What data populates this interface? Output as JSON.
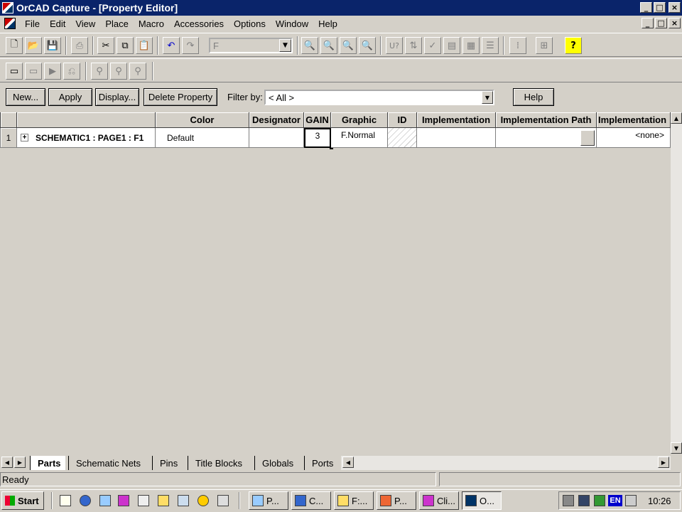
{
  "window": {
    "title": "OrCAD Capture - [Property Editor]",
    "min": "_",
    "max": "□",
    "close": "×"
  },
  "menu": {
    "items": [
      "File",
      "Edit",
      "View",
      "Place",
      "Macro",
      "Accessories",
      "Options",
      "Window",
      "Help"
    ]
  },
  "toolbar": {
    "part_combo": "F"
  },
  "editor": {
    "new_label": "New...",
    "apply_label": "Apply",
    "display_label": "Display...",
    "delete_label": "Delete Property",
    "filter_label": "Filter by:",
    "filter_value": "< All >",
    "help_label": "Help"
  },
  "grid": {
    "headers": [
      "Color",
      "Designator",
      "GAIN",
      "Graphic",
      "ID",
      "Implementation",
      "Implementation Path",
      "Implementation"
    ],
    "row": {
      "number": "1",
      "expand": "+",
      "name": "SCHEMATIC1 : PAGE1 : F1",
      "color": "Default",
      "designator": "",
      "gain": "3",
      "graphic": "F.Normal",
      "id": "",
      "implementation": "",
      "implementation_path": "",
      "implementation_type": "<none>"
    }
  },
  "tabs": [
    "Parts",
    "Schematic Nets",
    "Pins",
    "Title Blocks",
    "Globals",
    "Ports"
  ],
  "status": {
    "text": "Ready"
  },
  "taskbar": {
    "start": "Start",
    "tasks": [
      "P...",
      "C...",
      "F:...",
      "P...",
      "Cli...",
      "O..."
    ],
    "lang": "EN",
    "clock": "10:26"
  },
  "colors": {
    "titlebar": "#0a246a",
    "face": "#d4d0c8"
  }
}
